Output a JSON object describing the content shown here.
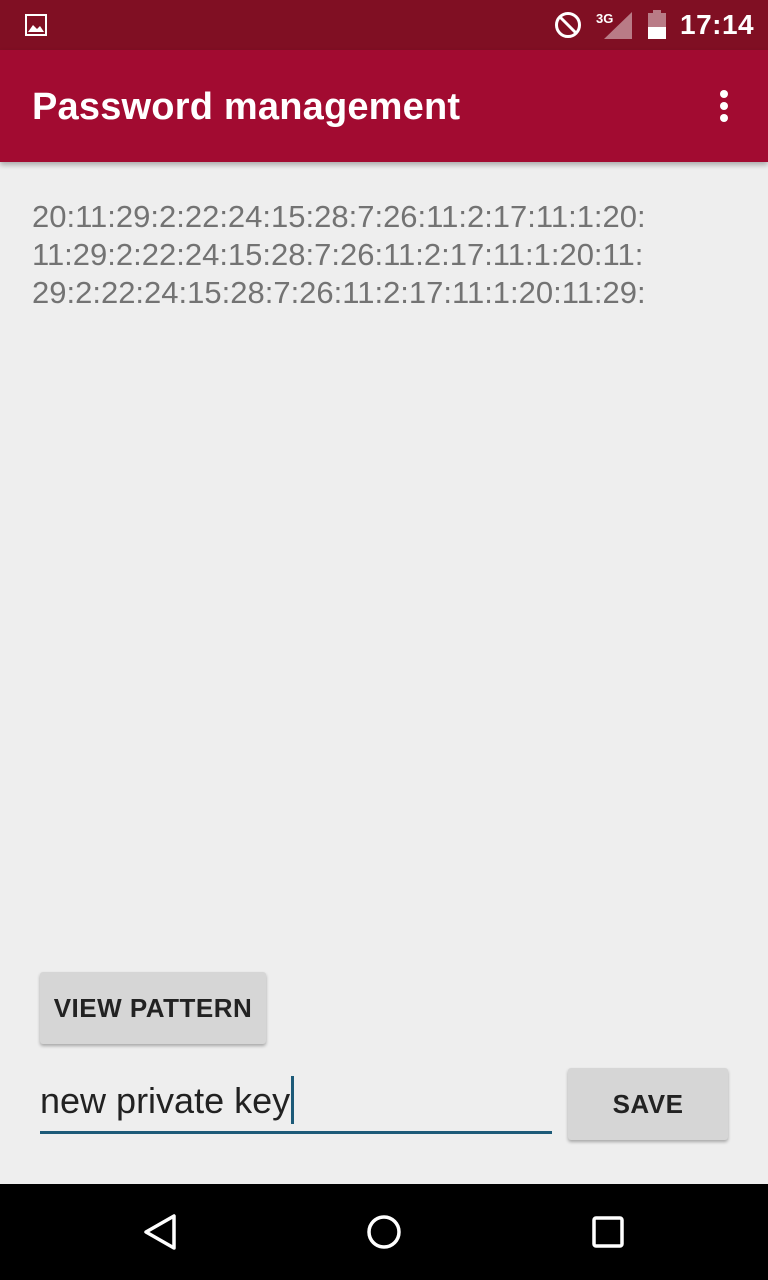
{
  "status_bar": {
    "time": "17:14",
    "network": "3G",
    "icons": [
      "gallery-icon",
      "do-not-disturb-icon",
      "signal-icon",
      "battery-icon"
    ]
  },
  "app_bar": {
    "title": "Password management",
    "menu_icon": "overflow-menu-icon"
  },
  "content": {
    "lines": [
      "20:11:29:2:22:24:15:28:7:26:11:2:17:11:1:20:",
      "11:29:2:22:24:15:28:7:26:11:2:17:11:1:20:11:",
      "29:2:22:24:15:28:7:26:11:2:17:11:1:20:11:29:"
    ]
  },
  "actions": {
    "view_pattern_label": "VIEW PATTERN",
    "key_input_value": "new private key",
    "save_label": "SAVE"
  },
  "nav_bar": {
    "icons": [
      "back-icon",
      "home-icon",
      "recents-icon"
    ]
  },
  "colors": {
    "status_bar": "#800f23",
    "app_bar": "#a20b31",
    "input_underline": "#1c5a78",
    "background": "#eeeeee"
  }
}
